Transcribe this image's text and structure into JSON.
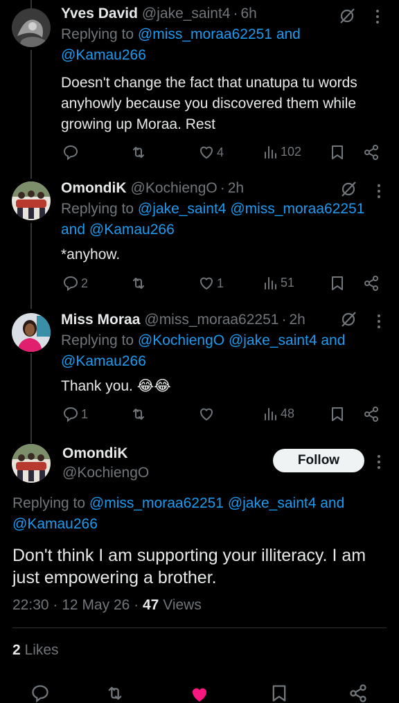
{
  "tweets": [
    {
      "name": "Yves David",
      "handle": "@jake_saint4",
      "time": "6h",
      "replying_prefix": "Replying to ",
      "mentions": [
        "@miss_moraa62251",
        "@Kamau266"
      ],
      "and": " and ",
      "text": "Doesn't change the fact that unatupa tu words anyhowly because you discovered them while growing up Moraa. Rest",
      "replies": "",
      "retweets": "",
      "likes": "4",
      "views": "102"
    },
    {
      "name": "OmondiK",
      "handle": "@KochiengO",
      "time": "2h",
      "replying_prefix": "Replying to ",
      "mentions": [
        "@jake_saint4",
        "@miss_moraa62251",
        "@Kamau266"
      ],
      "and": " and ",
      "text": "*anyhow.",
      "replies": "2",
      "retweets": "",
      "likes": "1",
      "views": "51"
    },
    {
      "name": "Miss Moraa",
      "handle": "@miss_moraa62251",
      "time": "2h",
      "replying_prefix": "Replying to ",
      "mentions": [
        "@KochiengO",
        "@jake_saint4",
        "@Kamau266"
      ],
      "and": " and ",
      "text": "Thank you. 😂😂",
      "replies": "1",
      "retweets": "",
      "likes": "",
      "views": "48"
    }
  ],
  "main_tweet": {
    "name": "OmondiK",
    "handle": "@KochiengO",
    "follow_label": "Follow",
    "replying_prefix": "Replying to ",
    "mentions": [
      "@miss_moraa62251",
      "@jake_saint4",
      "@Kamau266"
    ],
    "and": " and ",
    "text": "Don't think I am supporting your illiteracy. I am just empowering a brother.",
    "time": "22:30",
    "date": "12 May 26",
    "views_count": "47",
    "views_label": " Views",
    "likes_count": "2",
    "likes_label": " Likes"
  },
  "separator": "·",
  "colors": {
    "background": "#000000",
    "text": "#e7e9ea",
    "secondary": "#71767b",
    "mention": "#1d9bf0",
    "like_active": "#f91880"
  },
  "icons": [
    "reply-icon",
    "retweet-icon",
    "like-icon",
    "views-icon",
    "bookmark-icon",
    "share-icon",
    "grok-icon",
    "more-icon"
  ]
}
